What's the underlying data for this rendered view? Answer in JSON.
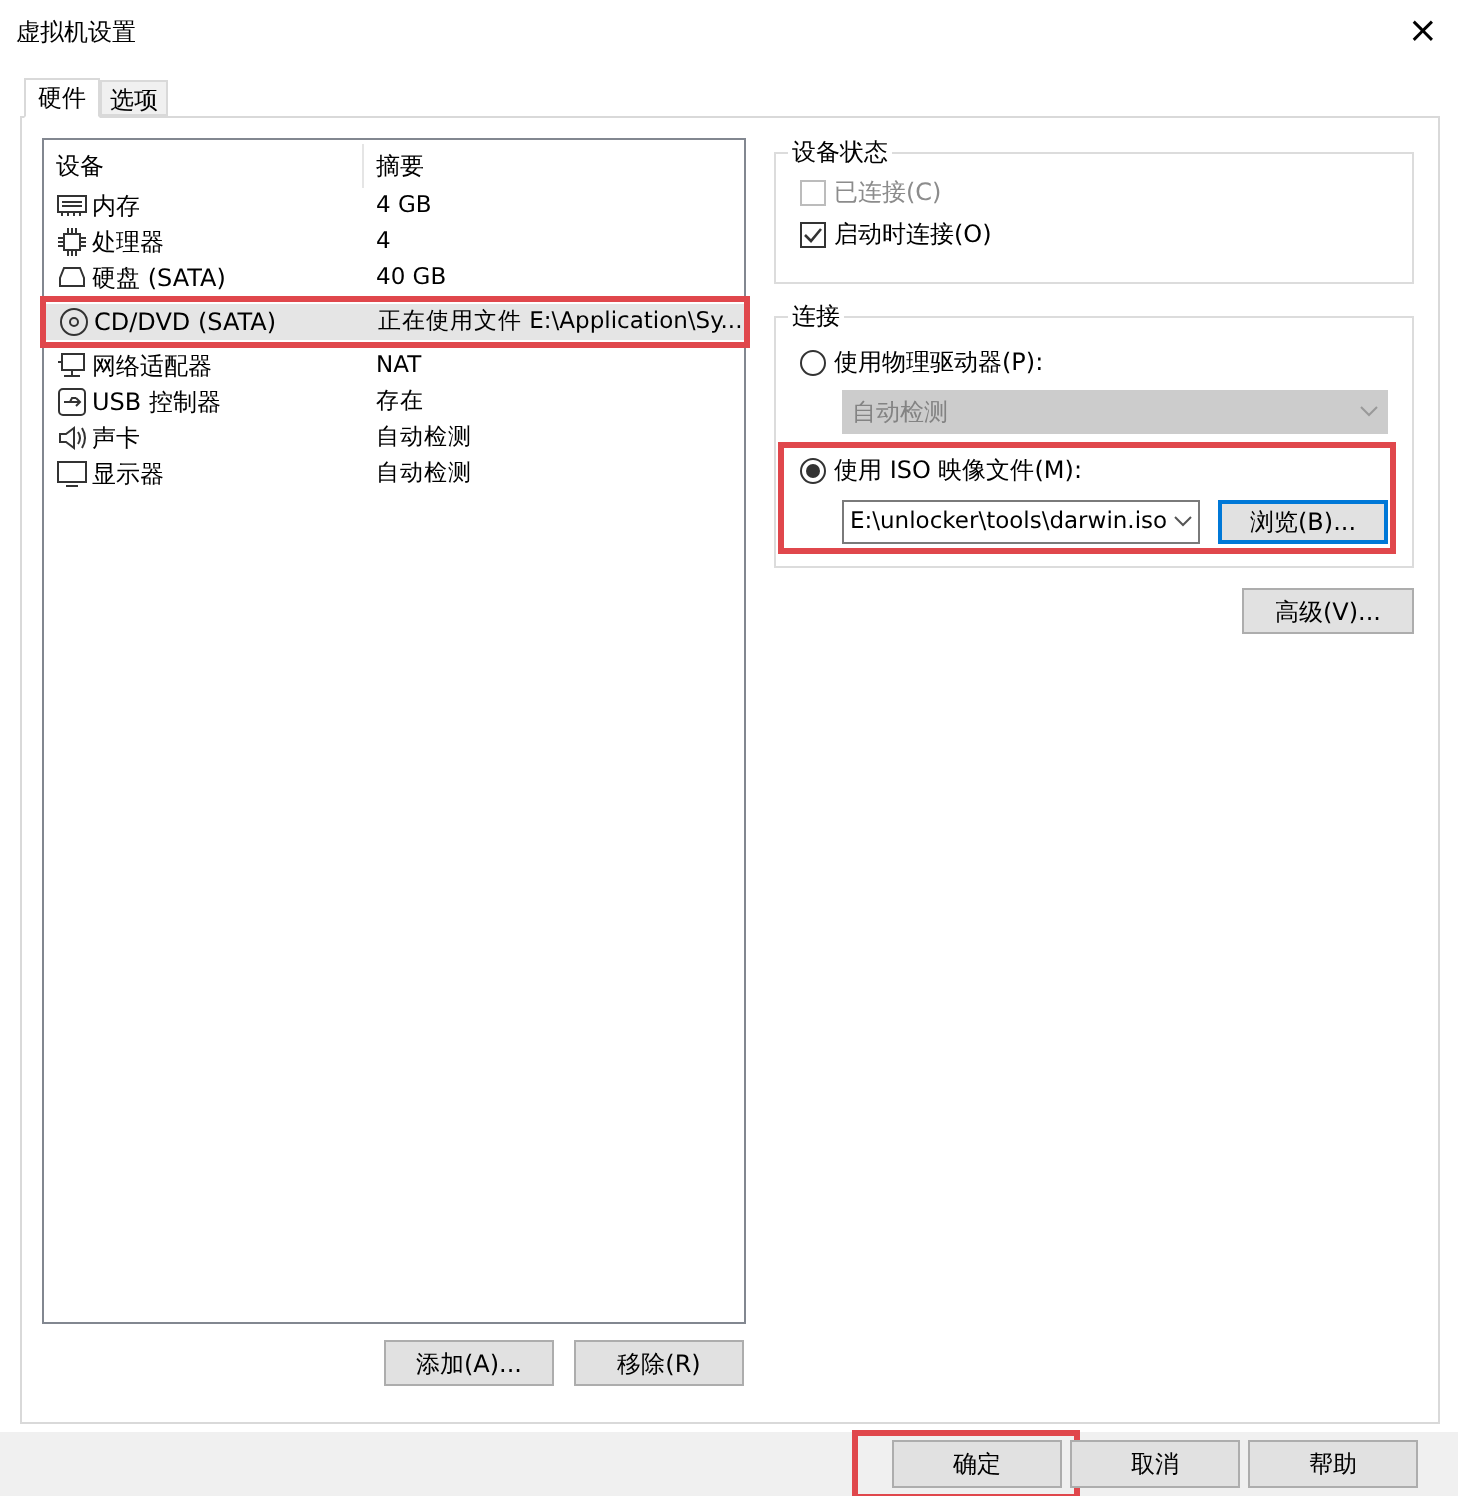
{
  "window": {
    "title": "虚拟机设置",
    "close": "×"
  },
  "tabs": [
    {
      "label": "硬件",
      "selected": true
    },
    {
      "label": "选项",
      "selected": false
    }
  ],
  "devices": {
    "columns": [
      "设备",
      "摘要"
    ],
    "rows": [
      {
        "kind": "memory",
        "name": "内存",
        "summary": "4 GB",
        "selected": false,
        "highlighted": false
      },
      {
        "kind": "cpu",
        "name": "处理器",
        "summary": "4",
        "selected": false,
        "highlighted": false
      },
      {
        "kind": "disk",
        "name": "硬盘 (SATA)",
        "summary": "40 GB",
        "selected": false,
        "highlighted": false
      },
      {
        "kind": "cd",
        "name": "CD/DVD (SATA)",
        "summary": "正在使用文件 E:\\Application\\Sy...",
        "selected": true,
        "highlighted": true
      },
      {
        "kind": "network",
        "name": "网络适配器",
        "summary": "NAT",
        "selected": false,
        "highlighted": false
      },
      {
        "kind": "usb",
        "name": "USB 控制器",
        "summary": "存在",
        "selected": false,
        "highlighted": false
      },
      {
        "kind": "sound",
        "name": "声卡",
        "summary": "自动检测",
        "selected": false,
        "highlighted": false
      },
      {
        "kind": "display",
        "name": "显示器",
        "summary": "自动检测",
        "selected": false,
        "highlighted": false
      }
    ],
    "buttons": [
      "添加(A)...",
      "移除(R)"
    ]
  },
  "device_status": {
    "title": "设备状态",
    "options": [
      {
        "label": "已连接(C)",
        "checked": false,
        "disabled": true
      },
      {
        "label": "启动时连接(O)",
        "checked": true,
        "disabled": false
      }
    ]
  },
  "connection": {
    "title": "连接",
    "physical": {
      "label": "使用物理驱动器(P):",
      "selected": false,
      "dropdown": {
        "value": "自动检测",
        "disabled": true
      }
    },
    "iso": {
      "label": "使用 ISO 映像文件(M):",
      "selected": true,
      "highlighted": true,
      "value": "E:\\unlocker\\tools\\darwin.iso",
      "browse": "浏览(B)..."
    }
  },
  "advanced_button": "高级(V)...",
  "footer": [
    {
      "label": "确定",
      "highlighted": true
    },
    {
      "label": "取消",
      "highlighted": false
    },
    {
      "label": "帮助",
      "highlighted": false
    }
  ]
}
